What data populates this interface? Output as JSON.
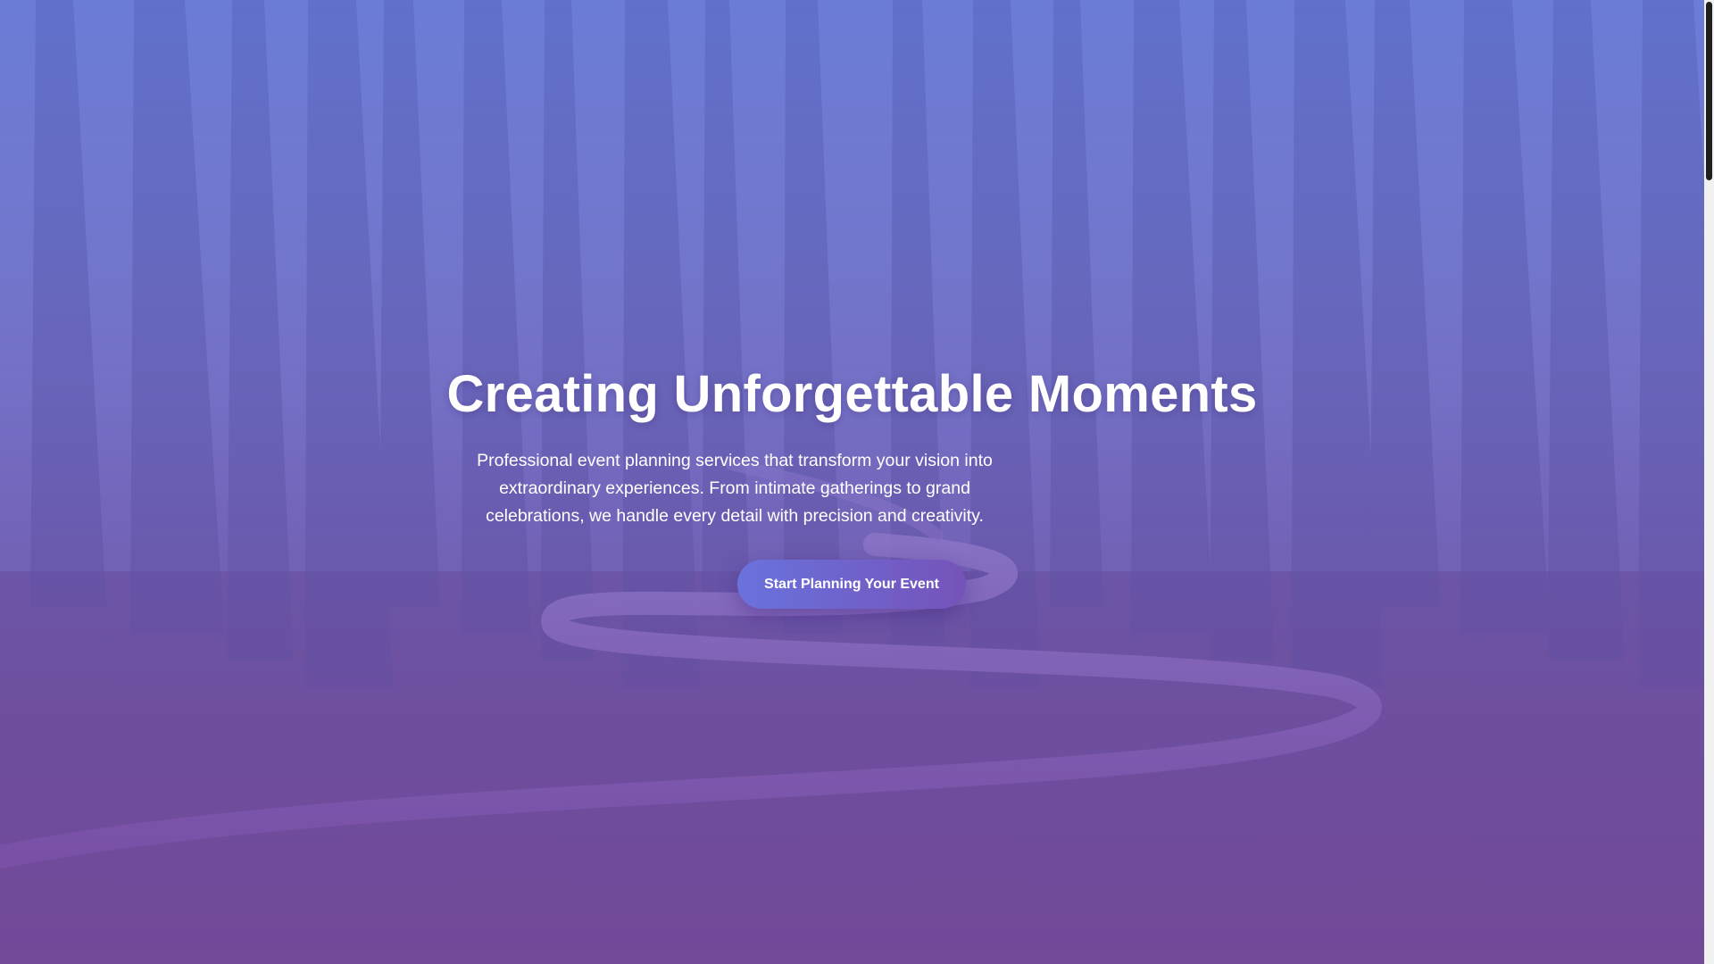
{
  "hero": {
    "title": "Creating Unforgettable Moments",
    "subtitle": "Professional event planning services that transform your vision into extraordinary experiences. From intimate gatherings to grand celebrations, we handle every detail with precision and creativity.",
    "cta_label": "Start Planning Your Event",
    "background": "forest path with winding fallen logs under purple-blue gradient overlay"
  },
  "colors": {
    "overlay_top": "#5c6ed2",
    "overlay_bottom": "#7a48a0",
    "button_start": "#6a72dd",
    "button_end": "#7553b9",
    "text": "#ffffff"
  },
  "scrollbar": {
    "scroll_position": 0
  }
}
